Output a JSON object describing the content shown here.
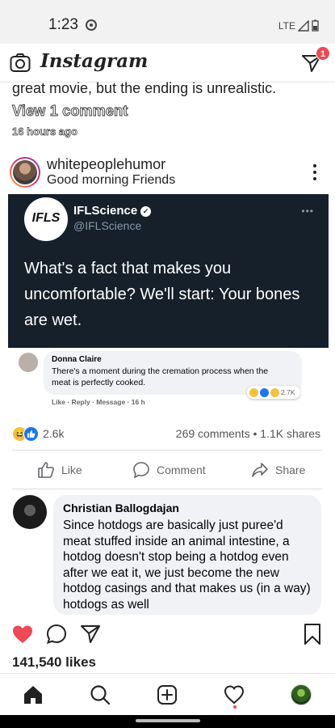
{
  "status_bar": {
    "time": "1:23",
    "network": "LTE"
  },
  "app": {
    "name": "Instagram",
    "dm_badge": "1"
  },
  "previous_post": {
    "caption_tail": "great movie, but the ending is unrealistic.",
    "view_comments": "View 1 comment",
    "time_ago": "16 hours ago"
  },
  "post": {
    "username": "whitepeoplehumor",
    "caption": "Good morning Friends",
    "tweet": {
      "avatar_text": "IFLS",
      "name": "IFLScience",
      "verified_mark": "✓",
      "handle": "@IFLScience",
      "more": "•••",
      "text": "What's a fact that makes you uncomfortable? We'll start: Your bones are wet."
    },
    "fb_comment": {
      "name": "Donna Claire",
      "text": "There's a moment during the cremation process when the meat is perfectly cooked.",
      "actions": "Like · Reply · Message · 16 h",
      "reaction_count": "2.7K"
    },
    "reactions": {
      "face": "😆",
      "count": "2.6k",
      "stats": "269 comments • 1.1K shares"
    },
    "actions": {
      "like_label": "Like",
      "comment_label": "Comment",
      "share_label": "Share"
    },
    "comment": {
      "author": "Christian Ballogdajan",
      "text": "Since hotdogs are basically just puree'd meat stuffed inside an animal intestine, a hotdog doesn't stop being a hotdog even after we eat it, we just become the new hotdog casings and that makes us (in a way) hotdogs as well"
    },
    "likes": "141,540 likes"
  },
  "bottom_nav": [
    "home-icon",
    "search-icon",
    "new-post-icon",
    "activity-icon",
    "profile-icon"
  ],
  "colors": {
    "heart": "#ed4956",
    "tweet_bg": "#15202b",
    "fb_blue": "#1877f2"
  }
}
